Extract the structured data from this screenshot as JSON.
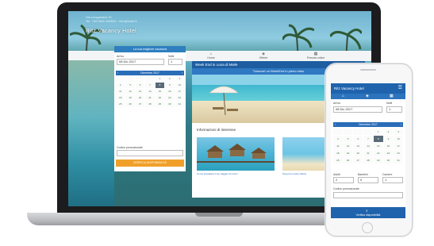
{
  "laptop": {
    "hotel_title": "Ritz Vacancy Hotel",
    "hotel_address": [
      "Via Lungomare 10",
      "Tel. +39 0541 000000 - info@hotel.it"
    ],
    "side_banner": "La tua migliore vacanza",
    "nav_tabs": [
      {
        "label": "Home",
        "icon": "home-icon"
      },
      {
        "label": "Offerte",
        "icon": "tag-icon"
      },
      {
        "label": "Prenota online",
        "icon": "calendar-icon"
      }
    ],
    "booking": {
      "arrival_label": "Arrivo",
      "arrival_value": "08 Dic 2017",
      "nights_label": "Notti",
      "nights_value": "1",
      "calendar_month": "Dicembre 2017",
      "calendar_days": [
        "",
        "",
        "",
        "",
        "1",
        "2",
        "3",
        "4",
        "5",
        "6",
        "7",
        "8",
        "9",
        "10",
        "11",
        "12",
        "13",
        "14",
        "15",
        "16",
        "17",
        "18",
        "19",
        "20",
        "21",
        "22",
        "23",
        "24",
        "25",
        "26",
        "27",
        "28",
        "29",
        "30",
        "31"
      ],
      "selected_day": "8",
      "promo_code_label": "Codice promozionale",
      "cta_label": "VERIFICA DISPONIBILITÀ"
    },
    "promo": {
      "title": "Week End in Luna di Miele",
      "subtitle": "Trascorri un WeekEnd in pieno relax"
    },
    "info": {
      "title": "Informazioni di Interesse",
      "items": [
        {
          "caption": "Come preparare il tuo viaggio di nozze"
        },
        {
          "caption": "Scopri le nostre offerte"
        }
      ]
    }
  },
  "phone": {
    "hotel_title": "Ritz Vacancy Hotel",
    "arrival_label": "Arrivo",
    "arrival_value": "08 Dic 2017",
    "nights_label": "Notti",
    "nights_value": "1",
    "calendar_month": "Dicembre 2017",
    "calendar_days": [
      "",
      "",
      "",
      "",
      "1",
      "2",
      "3",
      "4",
      "5",
      "6",
      "7",
      "8",
      "9",
      "10",
      "11",
      "12",
      "13",
      "14",
      "15",
      "16",
      "17",
      "18",
      "19",
      "20",
      "21",
      "22",
      "23",
      "24",
      "25",
      "26",
      "27",
      "28",
      "29",
      "30",
      "31"
    ],
    "selected_day": "8",
    "adults_label": "Adulti",
    "adults_value": "2",
    "children_label": "Bambini",
    "children_value": "0",
    "rooms_label": "Camere",
    "rooms_value": "1",
    "promo_code_label": "Codice promozionale",
    "cta_label": "Verifica disponibilità"
  },
  "colors": {
    "primary": "#1f63ad",
    "accent": "#f0a02a",
    "calendar_text": "#2e7d32"
  }
}
